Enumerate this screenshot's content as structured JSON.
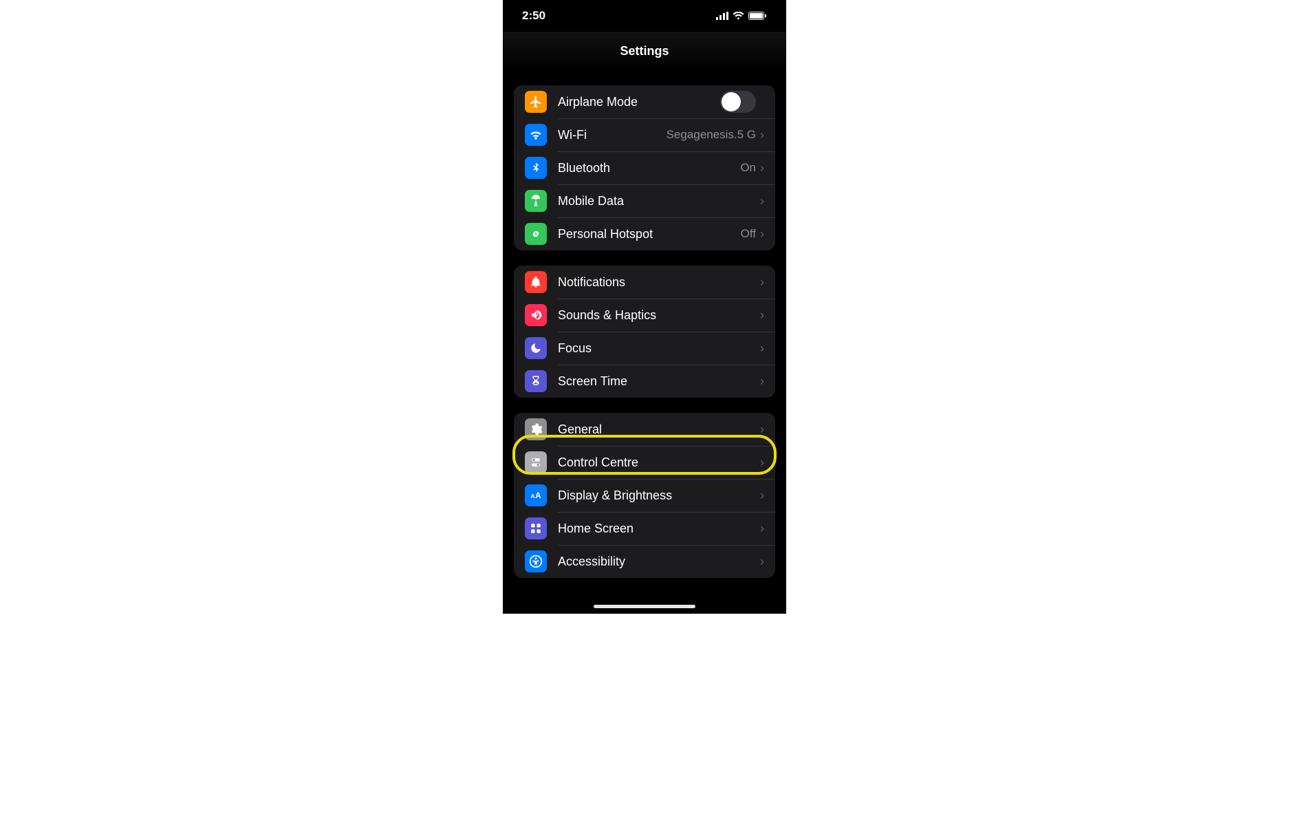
{
  "status": {
    "time": "2:50"
  },
  "header": {
    "title": "Settings"
  },
  "groups": [
    {
      "rows": [
        {
          "label": "Airplane Mode",
          "type": "toggle",
          "on": false,
          "data_name": "settings-row-airplane-mode"
        },
        {
          "label": "Wi-Fi",
          "value": "Segagenesis.5 G",
          "type": "disclosure",
          "data_name": "settings-row-wifi"
        },
        {
          "label": "Bluetooth",
          "value": "On",
          "type": "disclosure",
          "data_name": "settings-row-bluetooth"
        },
        {
          "label": "Mobile Data",
          "type": "disclosure",
          "data_name": "settings-row-mobile-data"
        },
        {
          "label": "Personal Hotspot",
          "value": "Off",
          "type": "disclosure",
          "data_name": "settings-row-personal-hotspot"
        }
      ]
    },
    {
      "rows": [
        {
          "label": "Notifications",
          "type": "disclosure",
          "data_name": "settings-row-notifications"
        },
        {
          "label": "Sounds & Haptics",
          "type": "disclosure",
          "data_name": "settings-row-sounds-haptics"
        },
        {
          "label": "Focus",
          "type": "disclosure",
          "data_name": "settings-row-focus"
        },
        {
          "label": "Screen Time",
          "type": "disclosure",
          "data_name": "settings-row-screen-time"
        }
      ]
    },
    {
      "rows": [
        {
          "label": "General",
          "type": "disclosure",
          "data_name": "settings-row-general",
          "highlighted": true
        },
        {
          "label": "Control Centre",
          "type": "disclosure",
          "data_name": "settings-row-control-centre"
        },
        {
          "label": "Display & Brightness",
          "type": "disclosure",
          "data_name": "settings-row-display-brightness"
        },
        {
          "label": "Home Screen",
          "type": "disclosure",
          "data_name": "settings-row-home-screen"
        },
        {
          "label": "Accessibility",
          "type": "disclosure",
          "data_name": "settings-row-accessibility"
        }
      ]
    }
  ],
  "highlight_target": "settings-row-general"
}
